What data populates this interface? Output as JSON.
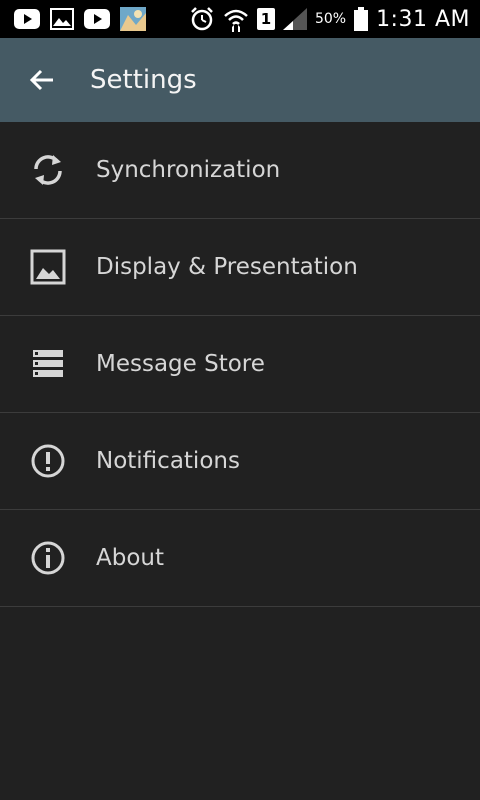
{
  "status_bar": {
    "notification_icons": [
      "youtube-icon",
      "gallery-icon",
      "youtube-icon",
      "app-thumbnail-icon"
    ],
    "system_icons": [
      "alarm-icon",
      "wifi-icon",
      "sim-1-icon",
      "signal-icon",
      "battery-icon"
    ],
    "sim_number": "1",
    "battery_percent": "50%",
    "time": "1:31 AM"
  },
  "app_bar": {
    "back_icon": "arrow-left-icon",
    "title": "Settings",
    "background_color": "#455a64"
  },
  "settings_items": [
    {
      "label": "Synchronization",
      "icon": "sync-icon"
    },
    {
      "label": "Display & Presentation",
      "icon": "image-icon"
    },
    {
      "label": "Message Store",
      "icon": "storage-icon"
    },
    {
      "label": "Notifications",
      "icon": "alert-circle-icon"
    },
    {
      "label": "About",
      "icon": "info-icon"
    }
  ],
  "colors": {
    "background": "#212121",
    "divider": "#3c3c3c",
    "text": "#d6d6d6",
    "status_bar": "#000000"
  }
}
